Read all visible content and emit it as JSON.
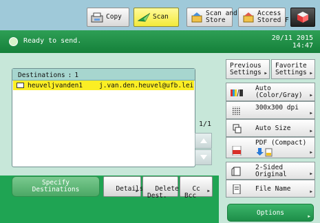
{
  "top_tabs": {
    "copy": "Copy",
    "scan": "Scan",
    "scan_store": "Scan and\nStore",
    "access_stored": "Access\nStored F"
  },
  "status": {
    "message": "Ready to send.",
    "date": "20/11 2015",
    "time": "14:47"
  },
  "destinations": {
    "header_label": "Destinations",
    "header_sep": ":",
    "count": "1",
    "rows": [
      {
        "name": "heuveljvanden1",
        "address": "j.van.den.heuvel@ufb.lei"
      }
    ],
    "page": "1/1"
  },
  "left_buttons": {
    "specify": "Specify\nDestinations",
    "details": "Details",
    "delete": "Delete\nDest.",
    "cc_bcc": "Cc\nBcc"
  },
  "right_panel": {
    "previous": "Previous\nSettings",
    "favorite": "Favorite\nSettings",
    "color": "Auto\n(Color/Gray)",
    "resolution": "300x300 dpi",
    "size": "Auto Size",
    "format": "PDF (Compact)",
    "sided": "2-Sided\nOriginal",
    "filename": "File Name",
    "options": "Options"
  },
  "colors": {
    "top_bar": "#9fc9d9",
    "status_green": "#1f8f45",
    "selected_row": "#fbee24",
    "active_tab": "#f6ee4a"
  }
}
